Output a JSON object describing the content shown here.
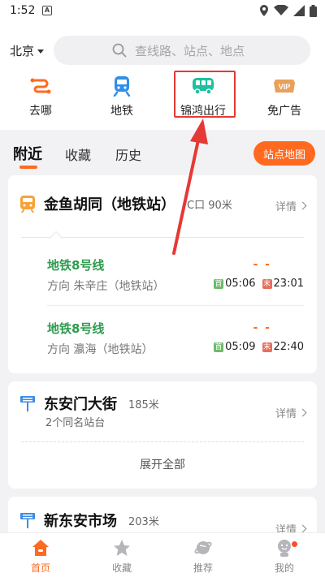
{
  "status": {
    "time": "1:52",
    "notification": "A"
  },
  "header": {
    "city": "北京",
    "search_placeholder": "查线路、站点、地点"
  },
  "quick_actions": [
    {
      "label": "去哪",
      "icon": "route-icon"
    },
    {
      "label": "地铁",
      "icon": "subway-icon"
    },
    {
      "label": "锦鸿出行",
      "icon": "bus-icon"
    },
    {
      "label": "免广告",
      "icon": "vip-icon"
    }
  ],
  "tabs": {
    "nearby": "附近",
    "favorites": "收藏",
    "history": "历史"
  },
  "map_button": "站点地图",
  "stations": [
    {
      "name": "金鱼胡同（地铁站）",
      "distance": "C口 90米",
      "detail": "详情",
      "lines": [
        {
          "name": "地铁8号线",
          "direction": "方向 朱辛庄（地铁站）",
          "status": "- -",
          "first_tag": "首",
          "first": "05:06",
          "last_tag": "末",
          "last": "23:01"
        },
        {
          "name": "地铁8号线",
          "direction": "方向 瀛海（地铁站）",
          "status": "- -",
          "first_tag": "首",
          "first": "05:09",
          "last_tag": "末",
          "last": "22:40"
        }
      ]
    },
    {
      "name": "东安门大街",
      "distance": "185米",
      "sub": "2个同名站台",
      "detail": "详情",
      "expand": "展开全部"
    },
    {
      "name": "新东安市场",
      "distance": "203米",
      "detail": "详情"
    }
  ],
  "bottom_nav": [
    {
      "label": "首页"
    },
    {
      "label": "收藏"
    },
    {
      "label": "推荐"
    },
    {
      "label": "我的"
    }
  ],
  "colors": {
    "accent": "#ff6a20",
    "line_green": "#2e9c4e",
    "highlight": "#e53935"
  }
}
